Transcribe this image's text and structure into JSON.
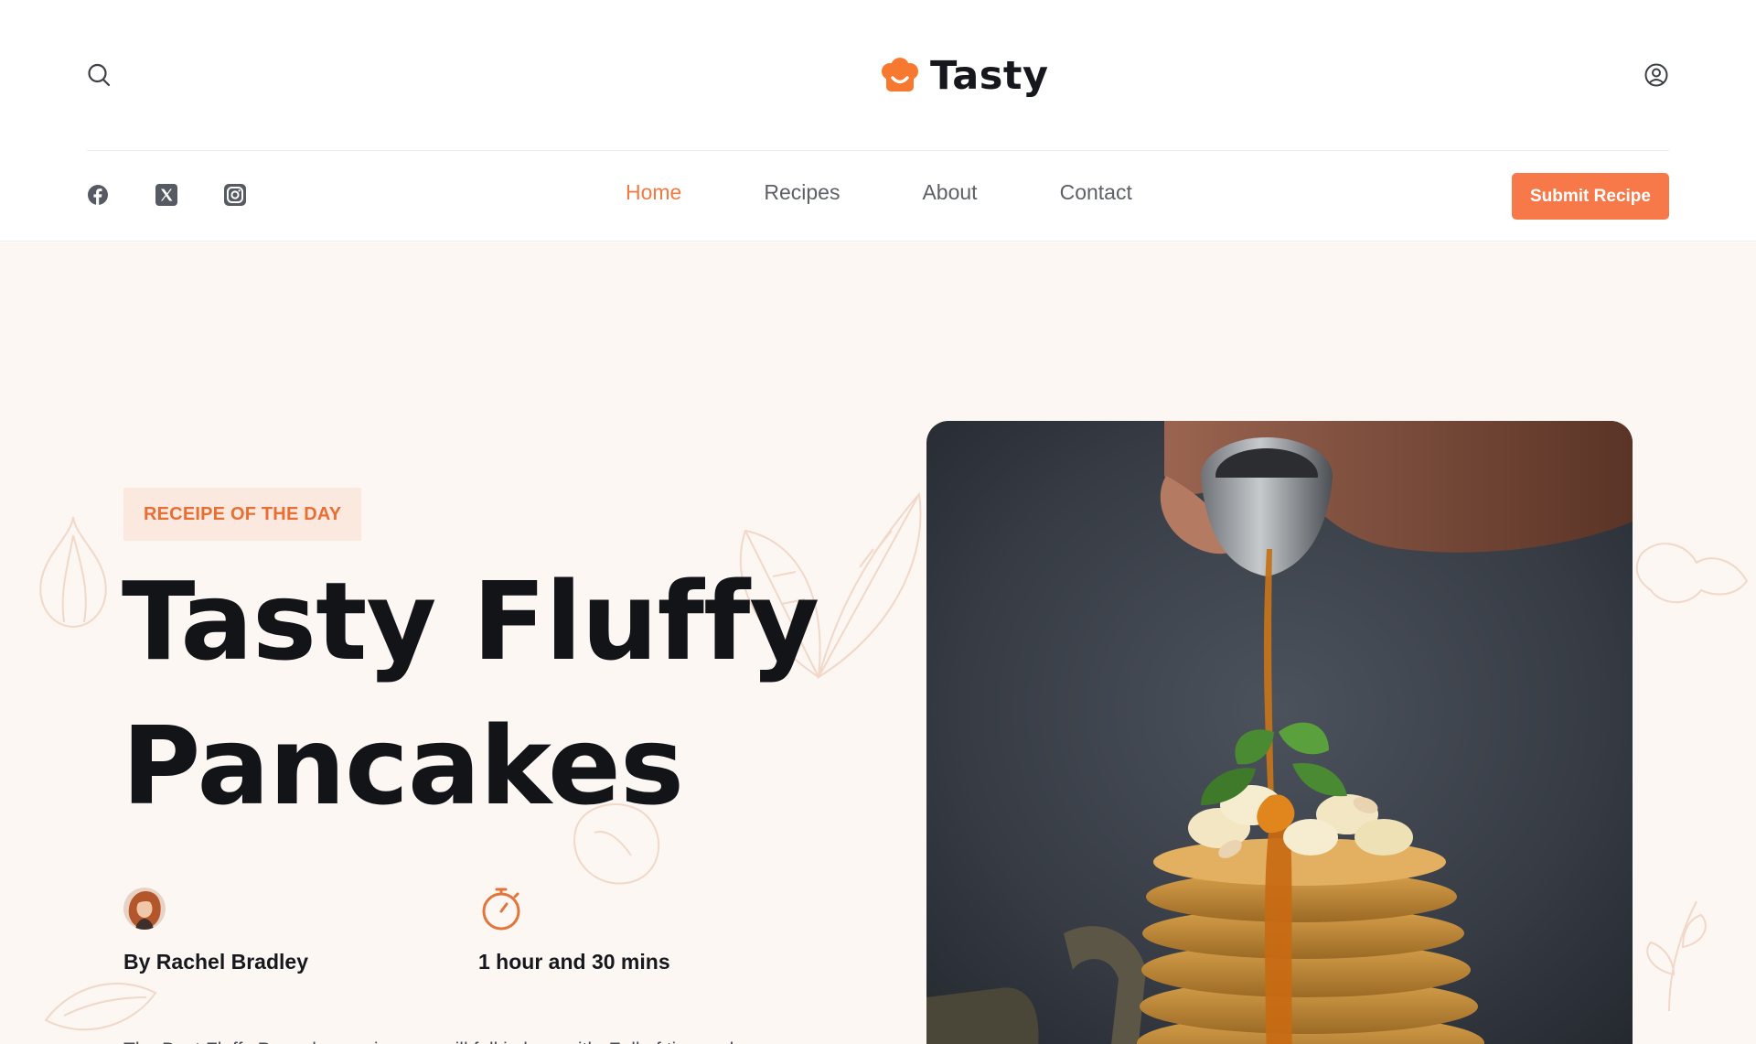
{
  "brand": {
    "name": "Tasty",
    "accent": "#f7794a"
  },
  "header": {
    "search_icon": "search-icon",
    "account_icon": "user-circle-icon"
  },
  "social": [
    {
      "name": "facebook",
      "icon": "facebook-icon"
    },
    {
      "name": "x",
      "icon": "x-icon"
    },
    {
      "name": "instagram",
      "icon": "instagram-icon"
    }
  ],
  "nav": {
    "items": [
      {
        "label": "Home",
        "active": true
      },
      {
        "label": "Recipes",
        "active": false
      },
      {
        "label": "About",
        "active": false
      },
      {
        "label": "Contact",
        "active": false
      }
    ],
    "cta_label": "Submit Recipe"
  },
  "hero": {
    "badge": "RECEIPE OF THE DAY",
    "title": "Tasty Fluffy Pancakes",
    "author": "By Rachel Bradley",
    "time": "1 hour and 30 mins",
    "intro": "The Best Fluffy Pancakes recipe you will fall in love with. Full of tips and"
  },
  "colors": {
    "hero_bg": "#fdf7f4",
    "badge_bg": "#fbe8de",
    "badge_text": "#e86f34",
    "nav_active": "#f27a42"
  }
}
